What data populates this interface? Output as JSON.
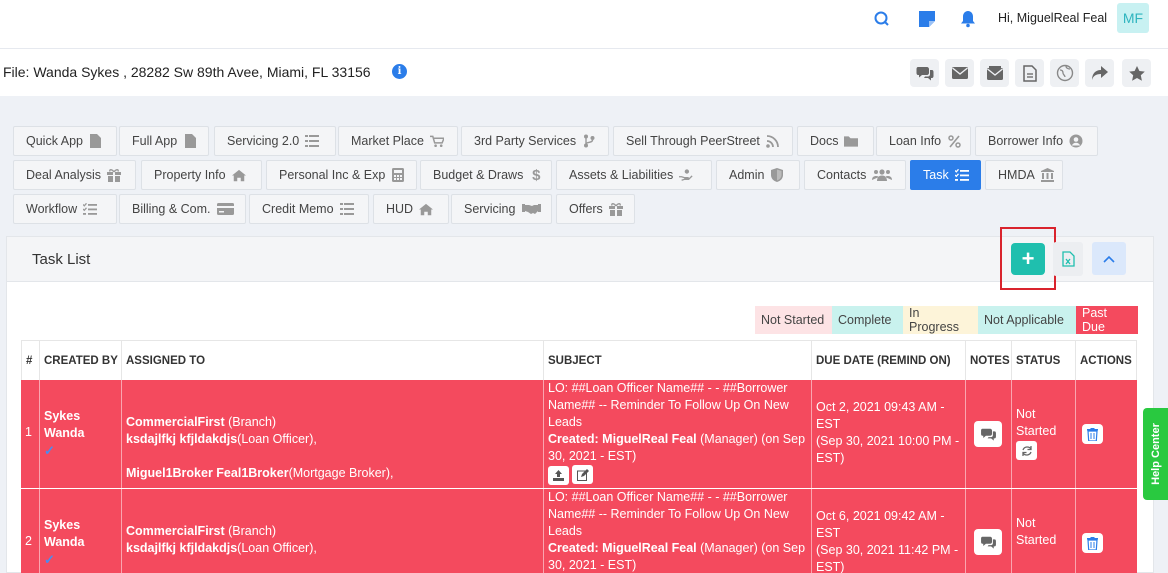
{
  "header": {
    "greeting": "Hi, MiguelReal Feal",
    "avatar_initials": "MF"
  },
  "file": {
    "title": "File: Wanda Sykes , 28282 Sw 89th Avee, Miami, FL 33156",
    "info_glyph": "i"
  },
  "tabs": {
    "row1": [
      {
        "label": "Quick App",
        "icon": "document-icon"
      },
      {
        "label": "Full App",
        "icon": "document-icon"
      },
      {
        "label": "Servicing 2.0",
        "icon": "list-icon"
      },
      {
        "label": "Market Place",
        "icon": "cart-icon"
      },
      {
        "label": "3rd Party Services",
        "icon": "branch-icon"
      },
      {
        "label": "Sell Through PeerStreet",
        "icon": "rss-icon"
      },
      {
        "label": "Docs",
        "icon": "folder-icon"
      },
      {
        "label": "Loan Info",
        "icon": "percent-icon"
      },
      {
        "label": "Borrower Info",
        "icon": "user-circle-icon"
      }
    ],
    "row2": [
      {
        "label": "Deal Analysis",
        "icon": "gift-icon"
      },
      {
        "label": "Property Info",
        "icon": "home-icon"
      },
      {
        "label": "Personal Inc & Exp",
        "icon": "calculator-icon"
      },
      {
        "label": "Budget & Draws",
        "icon": "dollar-icon"
      },
      {
        "label": "Assets & Liabilities",
        "icon": "hand-coin-icon"
      },
      {
        "label": "Admin",
        "icon": "shield-icon"
      },
      {
        "label": "Contacts",
        "icon": "users-icon"
      },
      {
        "label": "Task",
        "icon": "tasks-icon"
      },
      {
        "label": "HMDA",
        "icon": "building-icon"
      }
    ],
    "row3": [
      {
        "label": "Workflow",
        "icon": "tasks-icon"
      },
      {
        "label": "Billing & Com.",
        "icon": "credit-card-icon"
      },
      {
        "label": "Credit Memo",
        "icon": "list-icon"
      },
      {
        "label": "HUD",
        "icon": "home-icon"
      },
      {
        "label": "Servicing",
        "icon": "handshake-icon"
      },
      {
        "label": "Offers",
        "icon": "gift-icon"
      }
    ]
  },
  "task_list": {
    "title": "Task List",
    "add_label": "+",
    "legend": [
      "Not Started",
      "Complete",
      "In Progress",
      "Not Applicable",
      "Past Due"
    ],
    "colors": {
      "not_started": "#fde3e5",
      "complete": "#c9f2ee",
      "in_progress": "#fdf4d9",
      "not_applicable": "#c9f2ee",
      "past_due": "#f44a5e"
    },
    "columns": [
      "#",
      "CREATED BY",
      "ASSIGNED TO",
      "SUBJECT",
      "DUE DATE (REMIND ON)",
      "NOTES",
      "STATUS",
      "ACTIONS"
    ],
    "rows": [
      {
        "num": "1",
        "created_by": "Sykes Wanda",
        "assignee1_name": "CommercialFirst",
        "assignee1_role": " (Branch)",
        "assignee2_name": "ksdajlfkj kfjldakdjs",
        "assignee2_role": "(Loan Officer),",
        "assignee3_name": "Miguel1Broker Feal1Broker",
        "assignee3_role": "(Mortgage Broker),",
        "subject": "LO: ##Loan Officer Name## - - ##Borrower Name## -- Reminder To Follow Up On New Leads",
        "created_label": "Created: MiguelReal Feal",
        "created_suffix": " (Manager) (on Sep 30, 2021 - EST)",
        "due": "Oct 2, 2021 09:43 AM - EST",
        "remind": "(Sep 30, 2021 10:00 PM - EST)",
        "status": "Not Started"
      },
      {
        "num": "2",
        "created_by": "Sykes Wanda",
        "assignee1_name": "CommercialFirst",
        "assignee1_role": " (Branch)",
        "assignee2_name": "ksdajlfkj kfjldakdjs",
        "assignee2_role": "(Loan Officer),",
        "subject": "LO: ##Loan Officer Name## - - ##Borrower Name## -- Reminder To Follow Up On New Leads",
        "created_label": "Created: MiguelReal Feal",
        "created_suffix": " (Manager) (on Sep 30, 2021 - EST)",
        "due": "Oct 6, 2021 09:42 AM - EST",
        "remind": "(Sep 30, 2021 11:42 PM - EST)",
        "status": "Not Started"
      }
    ]
  },
  "help_center": "Help Center"
}
